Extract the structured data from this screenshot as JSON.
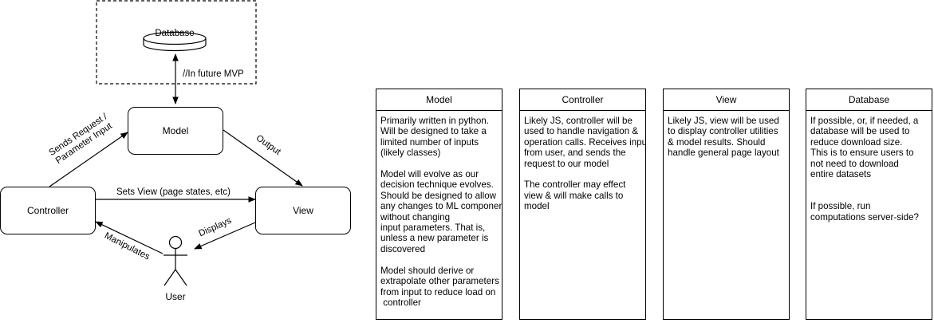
{
  "diagram": {
    "database_label": "Database",
    "future_note": "//In future MVP",
    "model_label": "Model",
    "controller_label": "Controller",
    "view_label": "View",
    "user_label": "User",
    "edges": {
      "sends_request": "Sends Request /\nParameter Input",
      "output": "Output",
      "sets_view": "Sets View (page states, etc)",
      "displays": "Displays",
      "manipulates": "Manipulates"
    }
  },
  "panels": [
    {
      "title": "Model",
      "body": "Primarily written in python.\nWill be designed to take a\nlimited number of inputs\n(likely classes)\n\nModel will evolve as our\ndecision technique evolves.\nShould be designed to allow\nany changes to ML components\nwithout changing\ninput parameters. That is,\nunless a new parameter is\ndiscovered\n\nModel should derive or\nextrapolate other parameters\nfrom input to reduce load on\n controller"
    },
    {
      "title": "Controller",
      "body": "Likely JS, controller will be\nused to handle navigation &\noperation calls. Receives input\nfrom user, and sends the\nrequest to our model\n\nThe controller may effect\nview & will make calls to\nmodel"
    },
    {
      "title": "View",
      "body": "Likely JS, view will be used\nto display controller utilities\n& model results. Should\nhandle general page layout"
    },
    {
      "title": "Database",
      "body": "If possible, or, if needed, a\ndatabase will be used to\nreduce download size.\nThis is to ensure users to\nnot need to download\nentire datasets\n\n\nIf possible, run\ncomputations server-side?"
    }
  ]
}
